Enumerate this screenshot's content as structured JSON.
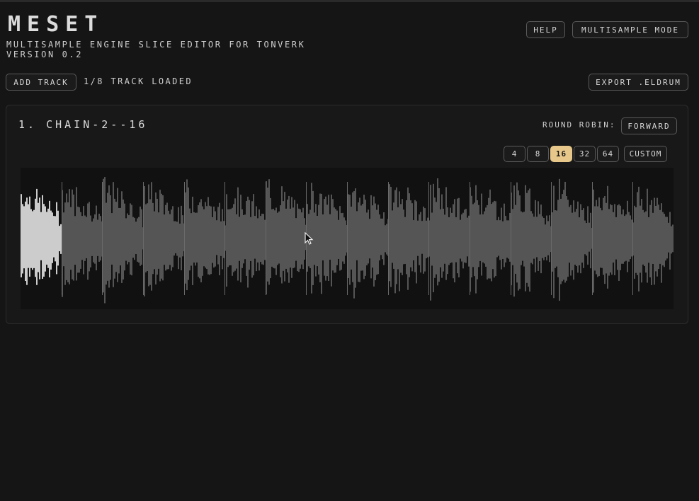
{
  "header": {
    "title": "MESET",
    "subtitle_line1": "MULTISAMPLE ENGINE SLICE EDITOR FOR TONVERK",
    "subtitle_line2": "VERSION 0.2",
    "help_label": "HELP",
    "mode_label": "MULTISAMPLE MODE"
  },
  "toolbar": {
    "add_track_label": "ADD TRACK",
    "status": "1/8 TRACK LOADED",
    "export_label": "EXPORT .ELDRUM"
  },
  "track": {
    "title": "1. CHAIN-2--16",
    "round_robin_label": "ROUND ROBIN:",
    "round_robin_value": "FORWARD",
    "slice_options": [
      "4",
      "8",
      "16",
      "32",
      "64"
    ],
    "selected_slices": "16",
    "custom_label": "CUSTOM",
    "slice_count": 16,
    "selected_slice": 1
  },
  "colors": {
    "background": "#151515",
    "accent": "#e8c88a",
    "waveform": "#555555",
    "waveform_selected": "#cccccc"
  }
}
